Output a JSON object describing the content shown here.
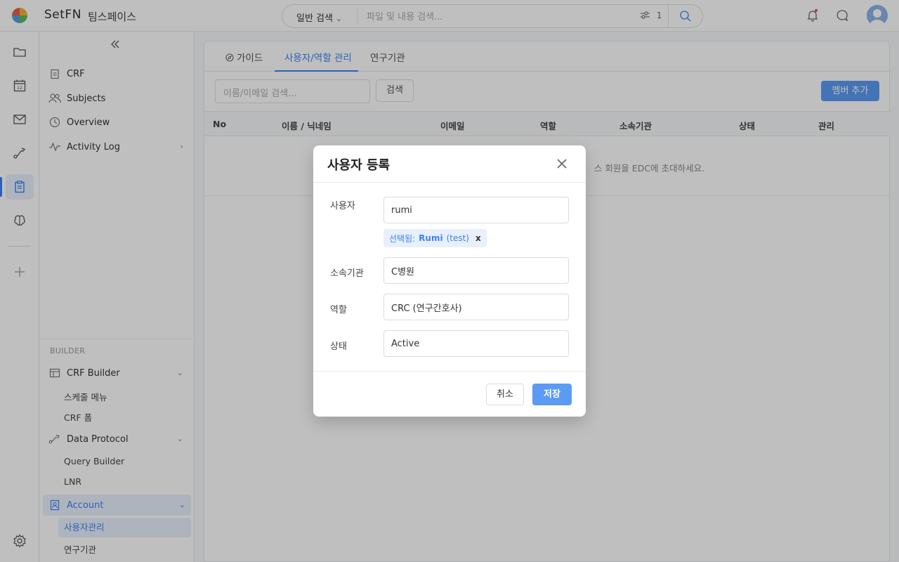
{
  "topbar": {
    "brand": "SetFN",
    "workspace": "팀스페이스",
    "search_mode": "일반 검색",
    "search_placeholder": "파일 및 내용 검색...",
    "filter_count": "1"
  },
  "sidebar": {
    "items": [
      {
        "label": "CRF"
      },
      {
        "label": "Subjects"
      },
      {
        "label": "Overview"
      },
      {
        "label": "Activity Log"
      }
    ],
    "builder_label": "BUILDER",
    "builder": {
      "crf_builder": "CRF Builder",
      "crf_sub": [
        "스케줄 메뉴",
        "CRF 폼"
      ],
      "data_protocol": "Data Protocol",
      "dp_sub": [
        "Query Builder",
        "LNR"
      ],
      "account": "Account",
      "account_sub": [
        "사용자관리",
        "연구기관"
      ]
    }
  },
  "main": {
    "tabs": [
      {
        "label": "가이드"
      },
      {
        "label": "사용자/역할 관리"
      },
      {
        "label": "연구기관"
      }
    ],
    "member_search_placeholder": "이름/이메일 검색...",
    "search_button": "검색",
    "add_member_button": "멤버 추가",
    "columns": [
      "No",
      "이름 / 닉네임",
      "이메일",
      "역할",
      "소속기관",
      "상태",
      "관리"
    ],
    "empty_text": "스 회원을 EDC에 초대하세요."
  },
  "modal": {
    "title": "사용자 등록",
    "user_label": "사용자",
    "user_value": "rumi",
    "chip_prefix": "선택됨:",
    "chip_name": "Rumi",
    "chip_suffix": "(test)",
    "chip_remove": "x",
    "org_label": "소속기관",
    "org_value": "C병원",
    "role_label": "역할",
    "role_value": "CRC (연구간호사)",
    "status_label": "상태",
    "status_value": "Active",
    "cancel": "취소",
    "save": "저장"
  },
  "colors": {
    "accent": "#3b82f6",
    "primary_button": "#5b9bf3",
    "overlay": "rgba(0,0,0,0.25)"
  }
}
